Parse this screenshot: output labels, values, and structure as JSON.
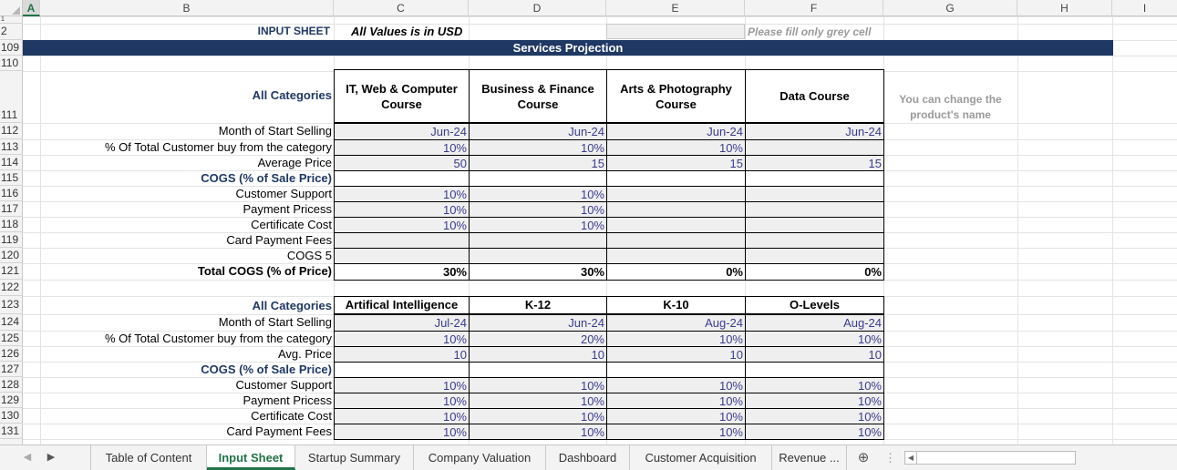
{
  "columns": [
    "A",
    "B",
    "C",
    "D",
    "E",
    "F",
    "G",
    "H",
    "I"
  ],
  "rows": [
    "1",
    "2",
    "109",
    "110",
    "111",
    "112",
    "113",
    "114",
    "115",
    "116",
    "117",
    "118",
    "119",
    "120",
    "121",
    "122",
    "123",
    "124",
    "125",
    "126",
    "127",
    "128",
    "129",
    "130",
    "131"
  ],
  "header": {
    "input_sheet": "INPUT SHEET",
    "values_note": "All Values is in USD",
    "fill_note": "Please fill only grey cell",
    "banner": "Services Projection"
  },
  "table1": {
    "all_categories": "All Categories",
    "products": [
      "IT, Web & Computer Course",
      "Business & Finance Course",
      "Arts & Photography Course",
      "Data Course"
    ],
    "side_note": "You can change the product's name",
    "rows": [
      {
        "label": "Month of Start Selling",
        "values": [
          "Jun-24",
          "Jun-24",
          "Jun-24",
          "Jun-24"
        ]
      },
      {
        "label": "% Of Total Customer buy from the category",
        "values": [
          "10%",
          "10%",
          "10%",
          ""
        ]
      },
      {
        "label": "Average Price",
        "values": [
          "50",
          "15",
          "15",
          "15"
        ]
      },
      {
        "label": "COGS (% of Sale Price)",
        "values": [
          "",
          "",
          "",
          ""
        ]
      },
      {
        "label": "Customer Support",
        "values": [
          "10%",
          "10%",
          "",
          ""
        ]
      },
      {
        "label": "Payment Pricess",
        "values": [
          "10%",
          "10%",
          "",
          ""
        ]
      },
      {
        "label": "Certificate Cost",
        "values": [
          "10%",
          "10%",
          "",
          ""
        ]
      },
      {
        "label": "Card Payment Fees",
        "values": [
          "",
          "",
          "",
          ""
        ]
      },
      {
        "label": "COGS 5",
        "values": [
          "",
          "",
          "",
          ""
        ]
      },
      {
        "label": "Total COGS (% of Price)",
        "values": [
          "30%",
          "30%",
          "0%",
          "0%"
        ]
      }
    ]
  },
  "table2": {
    "all_categories": "All Categories",
    "products": [
      "Artifical Intelligence",
      "K-12",
      "K-10",
      "O-Levels"
    ],
    "rows": [
      {
        "label": "Month of Start Selling",
        "values": [
          "Jul-24",
          "Jun-24",
          "Aug-24",
          "Aug-24"
        ]
      },
      {
        "label": "% Of Total Customer buy from the category",
        "values": [
          "10%",
          "20%",
          "10%",
          "10%"
        ]
      },
      {
        "label": "Avg. Price",
        "values": [
          "10",
          "10",
          "10",
          "10"
        ]
      },
      {
        "label": "COGS (% of Sale Price)",
        "values": [
          "",
          "",
          "",
          ""
        ]
      },
      {
        "label": "Customer Support",
        "values": [
          "10%",
          "10%",
          "10%",
          "10%"
        ]
      },
      {
        "label": "Payment Pricess",
        "values": [
          "10%",
          "10%",
          "10%",
          "10%"
        ]
      },
      {
        "label": "Certificate Cost",
        "values": [
          "10%",
          "10%",
          "10%",
          "10%"
        ]
      },
      {
        "label": "Card Payment Fees",
        "values": [
          "10%",
          "10%",
          "10%",
          "10%"
        ]
      }
    ]
  },
  "tabs": [
    "Table of Content",
    "Input Sheet",
    "Startup Summary",
    "Company Valuation",
    "Dashboard",
    "Customer Acquisition",
    "Revenue ..."
  ],
  "active_tab": "Input Sheet",
  "icons": {
    "prev": "triangle-left-icon",
    "next": "triangle-right-icon",
    "add": "plus-circle-icon",
    "more": "vertical-ellipsis-icon"
  },
  "colors": {
    "banner": "#1f3864",
    "accent": "#217346",
    "input_fill": "#efefef",
    "value_text": "#3b3b8f"
  }
}
